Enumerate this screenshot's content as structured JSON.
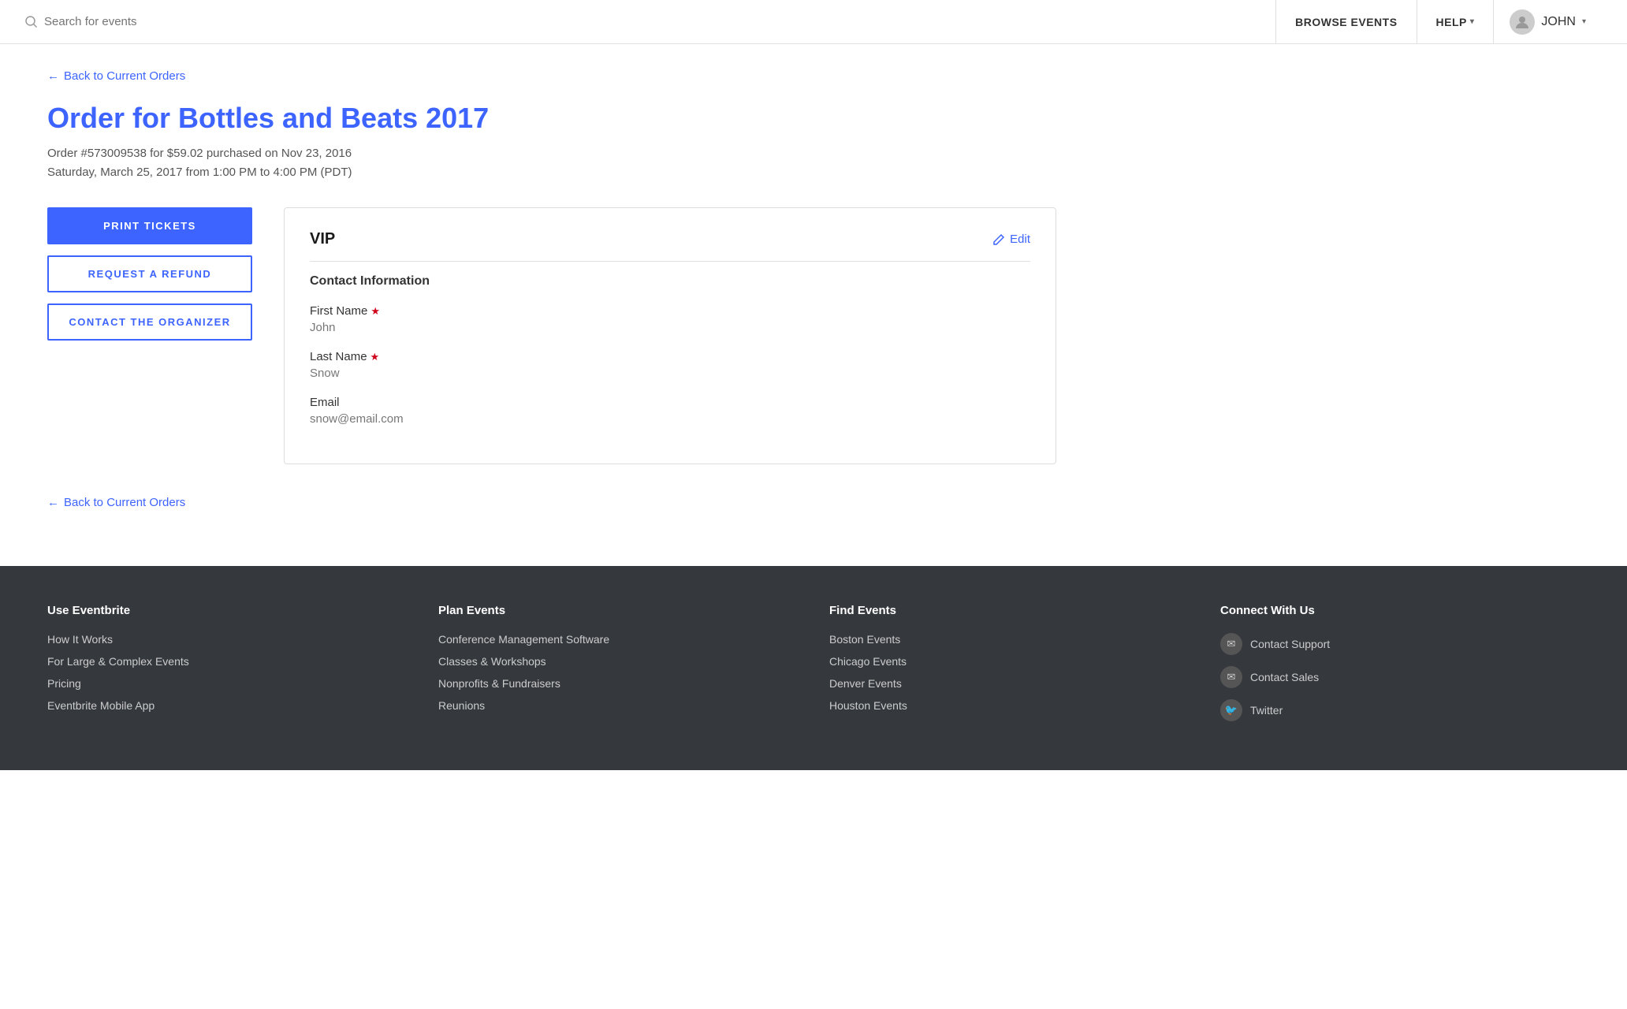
{
  "header": {
    "search_placeholder": "Search for events",
    "browse_label": "BROWSE EVENTS",
    "help_label": "HELP",
    "user_label": "JOHN"
  },
  "back_link_top": "Back to Current Orders",
  "back_link_bottom": "Back to Current Orders",
  "order": {
    "title_prefix": "Order for",
    "event_name": "Bottles and Beats 2017",
    "order_number": "Order #573009538 for $59.02 purchased on Nov 23, 2016",
    "event_date": "Saturday, March 25, 2017 from 1:00 PM to 4:00 PM (PDT)"
  },
  "buttons": {
    "print_tickets": "PRINT TICKETS",
    "request_refund": "REQUEST A REFUND",
    "contact_organizer": "CONTACT THE ORGANIZER"
  },
  "panel": {
    "ticket_type": "VIP",
    "edit_label": "Edit",
    "section_title": "Contact Information",
    "fields": [
      {
        "label": "First Name",
        "required": true,
        "value": "John"
      },
      {
        "label": "Last Name",
        "required": true,
        "value": "Snow"
      },
      {
        "label": "Email",
        "required": false,
        "value": "snow@email.com"
      }
    ]
  },
  "footer": {
    "cols": [
      {
        "title": "Use Eventbrite",
        "links": [
          "How It Works",
          "For Large & Complex Events",
          "Pricing",
          "Eventbrite Mobile App"
        ]
      },
      {
        "title": "Plan Events",
        "links": [
          "Conference Management Software",
          "Classes & Workshops",
          "Nonprofits & Fundraisers",
          "Reunions"
        ]
      },
      {
        "title": "Find Events",
        "links": [
          "Boston Events",
          "Chicago Events",
          "Denver Events",
          "Houston Events"
        ]
      },
      {
        "title": "Connect With Us",
        "social": [
          {
            "icon": "✉",
            "label": "Contact Support"
          },
          {
            "icon": "✉",
            "label": "Contact Sales"
          },
          {
            "icon": "🐦",
            "label": "Twitter"
          }
        ]
      }
    ]
  }
}
